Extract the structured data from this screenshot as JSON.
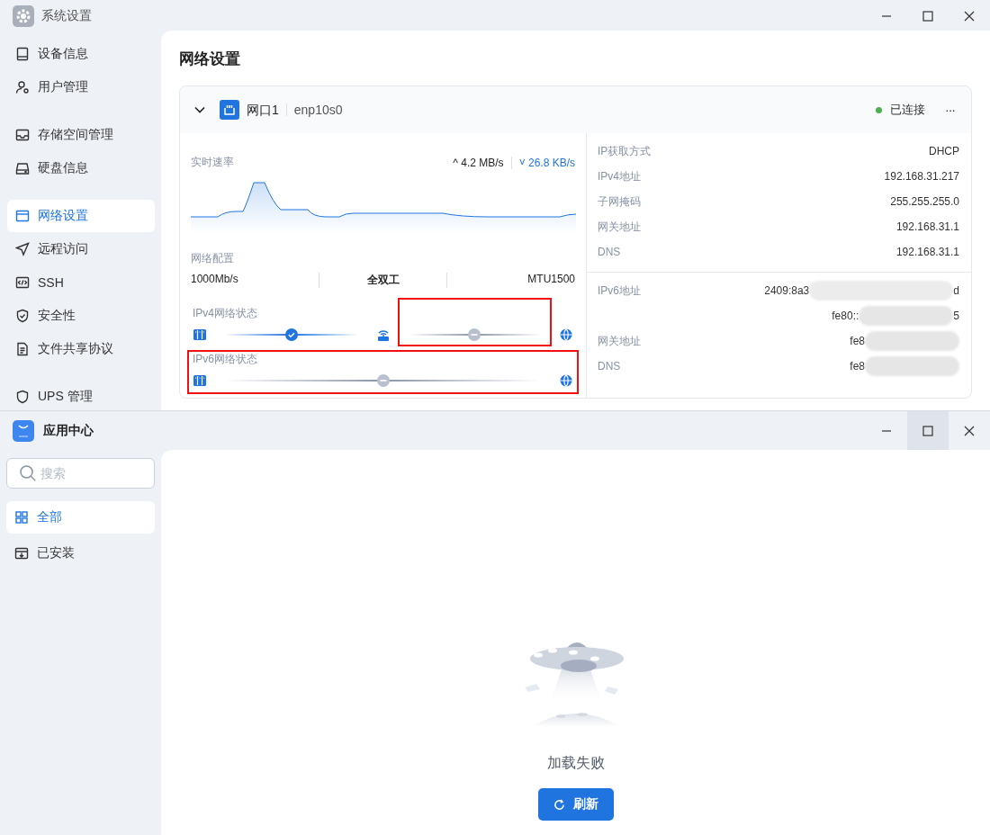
{
  "settings_window": {
    "title": "系统设置",
    "controls": [
      {
        "kind": "minimize",
        "hovered": false
      },
      {
        "kind": "maximize",
        "hovered": false
      },
      {
        "kind": "close",
        "hovered": false
      }
    ],
    "sidebar": {
      "groups": [
        [
          {
            "kind": "device",
            "label": "设备信息",
            "selected": false
          },
          {
            "kind": "user",
            "label": "用户管理",
            "selected": false
          }
        ],
        [
          {
            "kind": "storage",
            "label": "存储空间管理",
            "selected": false
          },
          {
            "kind": "disk",
            "label": "硬盘信息",
            "selected": false
          }
        ],
        [
          {
            "kind": "network",
            "label": "网络设置",
            "selected": true
          },
          {
            "kind": "send",
            "label": "远程访问",
            "selected": false
          },
          {
            "kind": "code",
            "label": "SSH",
            "selected": false
          },
          {
            "kind": "shield",
            "label": "安全性",
            "selected": false
          },
          {
            "kind": "file",
            "label": "文件共享协议",
            "selected": false
          }
        ],
        [
          {
            "kind": "ups",
            "label": "UPS 管理",
            "selected": false
          }
        ]
      ]
    },
    "page_title": "网络设置",
    "interface": {
      "expanded": true,
      "name": "网口1",
      "device": "enp10s0",
      "status": "已连接",
      "color": "#4caf50",
      "more": "···",
      "speed": {
        "label": "实时速率",
        "up_arrow": "^",
        "up": "4.2 MB/s",
        "down_arrow": "˅",
        "down": "26.8 KB/s"
      },
      "config": {
        "label": "网络配置",
        "values": [
          "1000Mb/s",
          "全双工",
          "MTU1500"
        ]
      },
      "ipv4_status": {
        "label": "IPv4网络状态",
        "nodes": [
          {
            "kind": "nas"
          },
          {
            "kind": "router"
          },
          {
            "kind": "globe"
          }
        ],
        "links": [
          {
            "connected": true
          },
          {
            "connected": false,
            "highlighted": true
          }
        ]
      },
      "ipv6_status": {
        "label": "IPv6网络状态",
        "highlighted": true,
        "nodes": [
          {
            "kind": "nas"
          },
          {
            "kind": "globe"
          }
        ],
        "links": [
          {
            "connected": false
          }
        ]
      },
      "ipv4_info": [
        {
          "label": "IP获取方式",
          "value": "DHCP"
        },
        {
          "label": "IPv4地址",
          "value": "192.168.31.217"
        },
        {
          "label": "子网掩码",
          "value": "255.255.255.0"
        },
        {
          "label": "网关地址",
          "value": "192.168.31.1"
        },
        {
          "label": "DNS",
          "value": "192.168.31.1"
        }
      ],
      "ipv6_info": [
        {
          "label": "IPv6地址",
          "value": "2409:8a3",
          "tail": "d",
          "redacted": true
        },
        {
          "value": "fe80::",
          "tail": "5",
          "redacted": true
        },
        {
          "label": "网关地址",
          "value": "fe8",
          "redacted": true
        },
        {
          "label": "DNS",
          "value": "fe8",
          "redacted": true
        }
      ]
    }
  },
  "app_window": {
    "title": "应用中心",
    "controls": [
      {
        "kind": "minimize",
        "hovered": false
      },
      {
        "kind": "maximize",
        "hovered": true
      },
      {
        "kind": "close",
        "hovered": false
      }
    ],
    "search": {
      "placeholder": "搜索"
    },
    "sidebar": {
      "items": [
        {
          "kind": "grid",
          "label": "全部",
          "selected": true
        },
        {
          "kind": "install",
          "label": "已安装",
          "selected": false
        }
      ]
    },
    "empty_state": {
      "message": "加载失败",
      "button": "刷新"
    }
  }
}
